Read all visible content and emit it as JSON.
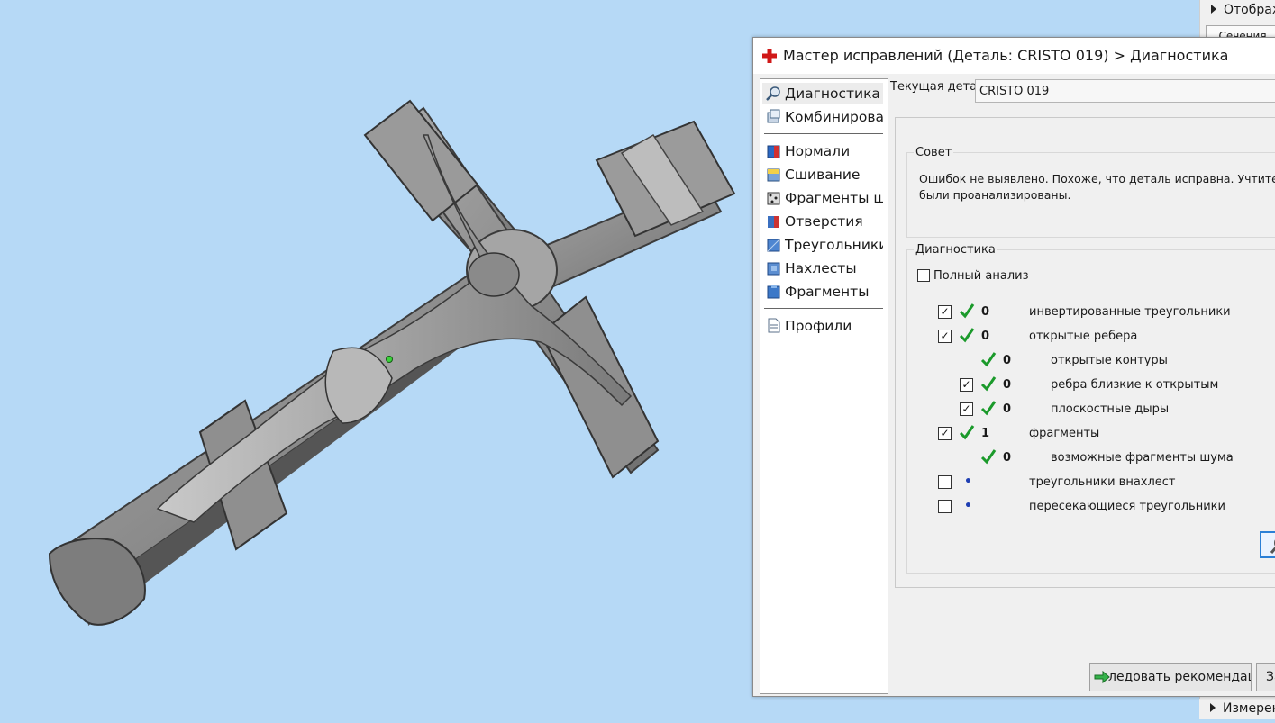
{
  "side_panel": {
    "top_item": "Отображ",
    "tab": "Сечения",
    "bottom_item": "Измерен"
  },
  "dialog": {
    "title": "Мастер исправлений (Деталь: CRISTO 019) > Диагностика",
    "nav": {
      "top_items": [
        {
          "label": "Диагностика",
          "icon": "magnifier-icon",
          "selected": true
        },
        {
          "label": "Комбинирова...",
          "icon": "combine-icon"
        }
      ],
      "middle_items": [
        {
          "label": "Нормали",
          "icon": "normals-icon"
        },
        {
          "label": "Сшивание",
          "icon": "stitch-icon"
        },
        {
          "label": "Фрагменты шу...",
          "icon": "noise-shells-icon"
        },
        {
          "label": "Отверстия",
          "icon": "holes-icon"
        },
        {
          "label": "Треугольники",
          "icon": "triangles-icon"
        },
        {
          "label": "Нахлесты",
          "icon": "overlaps-icon"
        },
        {
          "label": "Фрагменты",
          "icon": "shells-icon"
        }
      ],
      "bottom_items": [
        {
          "label": "Профили",
          "icon": "document-icon"
        }
      ]
    },
    "current_part": {
      "label": "Текущая деталь:",
      "value": "CRISTO 019"
    },
    "tip": {
      "title": "Совет",
      "line1": "Ошибок не выявлено. Похоже, что деталь исправна. Учтите, что не в",
      "line2": "были проанализированы."
    },
    "diagnostics": {
      "title": "Диагностика",
      "full_analysis": "Полный анализ",
      "rows": [
        {
          "label": "инвертированные треугольники",
          "count": "0",
          "checked": true,
          "level": 0,
          "status": "ok"
        },
        {
          "label": "открытые ребера",
          "count": "0",
          "checked": true,
          "level": 0,
          "status": "ok"
        },
        {
          "label": "открытые контуры",
          "count": "0",
          "checked": null,
          "level": 1,
          "status": "ok"
        },
        {
          "label": "ребра близкие к открытым",
          "count": "0",
          "checked": true,
          "level": 1,
          "status": "ok"
        },
        {
          "label": "плоскостные дыры",
          "count": "0",
          "checked": true,
          "level": 1,
          "status": "ok"
        },
        {
          "label": "фрагменты",
          "count": "1",
          "checked": true,
          "level": 0,
          "status": "ok"
        },
        {
          "label": "возможные фрагменты шума",
          "count": "0",
          "checked": null,
          "level": 1,
          "status": "ok"
        },
        {
          "label": "треугольники внахлест",
          "count": "",
          "checked": false,
          "level": 0,
          "status": "pending"
        },
        {
          "label": "пересекающиеся треугольники",
          "count": "",
          "checked": false,
          "level": 0,
          "status": "pending"
        }
      ]
    },
    "buttons": {
      "follow": "ледовать рекомендациям",
      "close": "За"
    }
  },
  "colors": {
    "viewport_bg": "#b6d9f6",
    "check_green": "#1b9a2b",
    "model_gray": "#8d8d8d"
  }
}
